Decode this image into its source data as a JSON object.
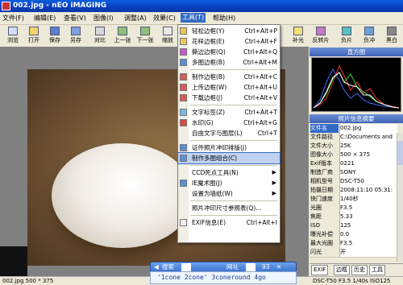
{
  "window": {
    "title": "002.jpg - nEO iMAGING"
  },
  "menubar": [
    "文件(F)",
    "编辑(E)",
    "查看(V)",
    "图像(I)",
    "调整(A)",
    "效果(C)",
    "工具(T)",
    "帮助(H)"
  ],
  "toolbar": [
    "浏览",
    "打开",
    "保存",
    "另存",
    "对比",
    "上一张",
    "下一张",
    "缩放",
    "补光",
    "反转片",
    "负片",
    "负冲",
    "黑白"
  ],
  "tools_menu": {
    "group1": [
      {
        "label": "轻松边框(Y)",
        "shortcut": "Ctrl+Alt+P"
      },
      {
        "label": "花样边框(E)",
        "shortcut": "Ctrl+Alt+F"
      },
      {
        "label": "撕边边框(Q)",
        "shortcut": "Ctrl+Alt+Q"
      },
      {
        "label": "多图边框(B)",
        "shortcut": "Ctrl+Alt+M"
      }
    ],
    "group2": [
      {
        "label": "制作边框(B)",
        "shortcut": "Ctrl+Alt+C"
      },
      {
        "label": "上传边框(W)",
        "shortcut": "Ctrl+Alt+U"
      },
      {
        "label": "下载边框(J)",
        "shortcut": "Ctrl+Alt+V"
      }
    ],
    "group3": [
      {
        "label": "文字标签(Z)",
        "shortcut": "Ctrl+Alt+T"
      },
      {
        "label": "水印(G)",
        "shortcut": "Ctrl+Alt+G"
      },
      {
        "label": "自由文字与图层(L)",
        "shortcut": "Ctrl+T"
      }
    ],
    "group4": [
      {
        "label": "证件照片冲印排版(J)",
        "shortcut": ""
      },
      {
        "label": "制作多图组合(C)",
        "shortcut": ""
      }
    ],
    "group5": [
      {
        "label": "CCD死点工具(N)",
        "shortcut": "",
        "submenu": true
      },
      {
        "label": "IE魔术图(J)",
        "shortcut": "",
        "submenu": true
      },
      {
        "label": "设置为墙纸(W)",
        "shortcut": "",
        "submenu": true
      }
    ],
    "group6": [
      {
        "label": "照片冲印尺寸参照表(Q)...",
        "shortcut": ""
      }
    ],
    "group7": [
      {
        "label": "EXIF信息(E)",
        "shortcut": "Ctrl+Alt+I"
      }
    ],
    "highlighted": "制作多图组合(C)"
  },
  "panel": {
    "histogram_title": "直方图",
    "info_title": "照片信息摘要",
    "rows": [
      {
        "k": "文件名",
        "v": "002.jpg"
      },
      {
        "k": "文件路径",
        "v": "C:\\Documents and"
      },
      {
        "k": "文件大小",
        "v": "25K"
      },
      {
        "k": "图像大小",
        "v": "500 × 375"
      },
      {
        "k": "Exif版本",
        "v": "0221"
      },
      {
        "k": "制造厂商",
        "v": "SONY"
      },
      {
        "k": "相机型号",
        "v": "DSC-T50"
      },
      {
        "k": "拍摄日期",
        "v": "2008:11:10 05:31:"
      },
      {
        "k": "快门速度",
        "v": "1/40秒"
      },
      {
        "k": "光圈",
        "v": "F3.5"
      },
      {
        "k": "焦距",
        "v": "5.33"
      },
      {
        "k": "ISO",
        "v": "125"
      },
      {
        "k": "曝光补偿",
        "v": "0.0"
      },
      {
        "k": "最大光圈",
        "v": "F3.5"
      },
      {
        "k": "闪光",
        "v": "开"
      }
    ],
    "tabs": [
      "EXIF",
      "边框",
      "历史",
      "工具"
    ]
  },
  "status": {
    "left": "002.jpg 500 * 375",
    "right": "DSC-T50 F3.5 1/40s ISO125"
  },
  "searchbar": {
    "search_label": "搜索",
    "web_label": "网址",
    "go_label": "93"
  },
  "hint": "'1cone 2cone' 3coneround 4go",
  "colors": {
    "titlebar": "#0a4fd0",
    "menu_highlight": "#316ac5",
    "panel_header": "#3f63b5"
  }
}
